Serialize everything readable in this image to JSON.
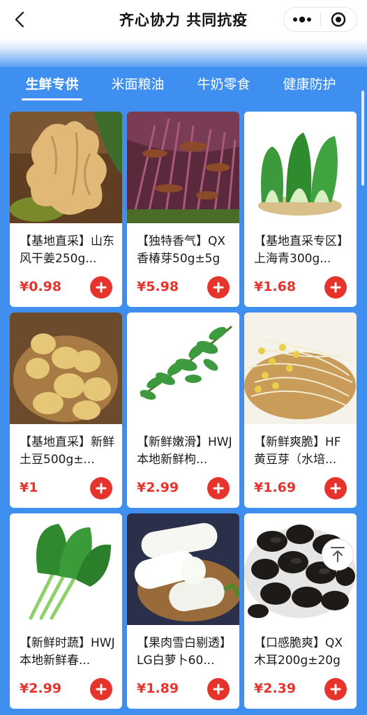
{
  "header": {
    "title": "齐心协力 共同抗疫",
    "back_icon": "chevron-left-icon",
    "menu_icon": "more-dots-icon",
    "close_icon": "target-circle-icon"
  },
  "tabs": [
    {
      "label": "生鲜专供",
      "active": true
    },
    {
      "label": "米面粮油",
      "active": false
    },
    {
      "label": "牛奶零食",
      "active": false
    },
    {
      "label": "健康防护",
      "active": false
    }
  ],
  "colors": {
    "accent": "#3f8ff0",
    "price": "#e8332d",
    "add_button": "#e6342c"
  },
  "products": [
    {
      "name": "【基地直采】山东风干姜250g...",
      "price": "¥0.98",
      "image": "ginger"
    },
    {
      "name": "【独特香气】QX香椿芽50g±5g",
      "price": "¥5.98",
      "image": "toon-sprouts"
    },
    {
      "name": "【基地直采专区】上海青300g...",
      "price": "¥1.68",
      "image": "bok-choy"
    },
    {
      "name": "【基地直采】新鲜土豆500g±...",
      "price": "¥1",
      "image": "potatoes"
    },
    {
      "name": "【新鲜嫩滑】HWJ本地新鲜枸...",
      "price": "¥2.99",
      "image": "goji-leaves"
    },
    {
      "name": "【新鲜爽脆】HF黄豆芽（水培...",
      "price": "¥1.69",
      "image": "bean-sprouts"
    },
    {
      "name": "【新鲜时蔬】HWJ本地新鲜春...",
      "price": "¥2.99",
      "image": "choy-sum"
    },
    {
      "name": "【果肉雪白剔透】LG白萝卜60...",
      "price": "¥1.89",
      "image": "white-radish"
    },
    {
      "name": "【口感脆爽】QX木耳200g±20g",
      "price": "¥2.39",
      "image": "wood-ear"
    }
  ],
  "back_to_top_icon": "arrow-up-icon"
}
